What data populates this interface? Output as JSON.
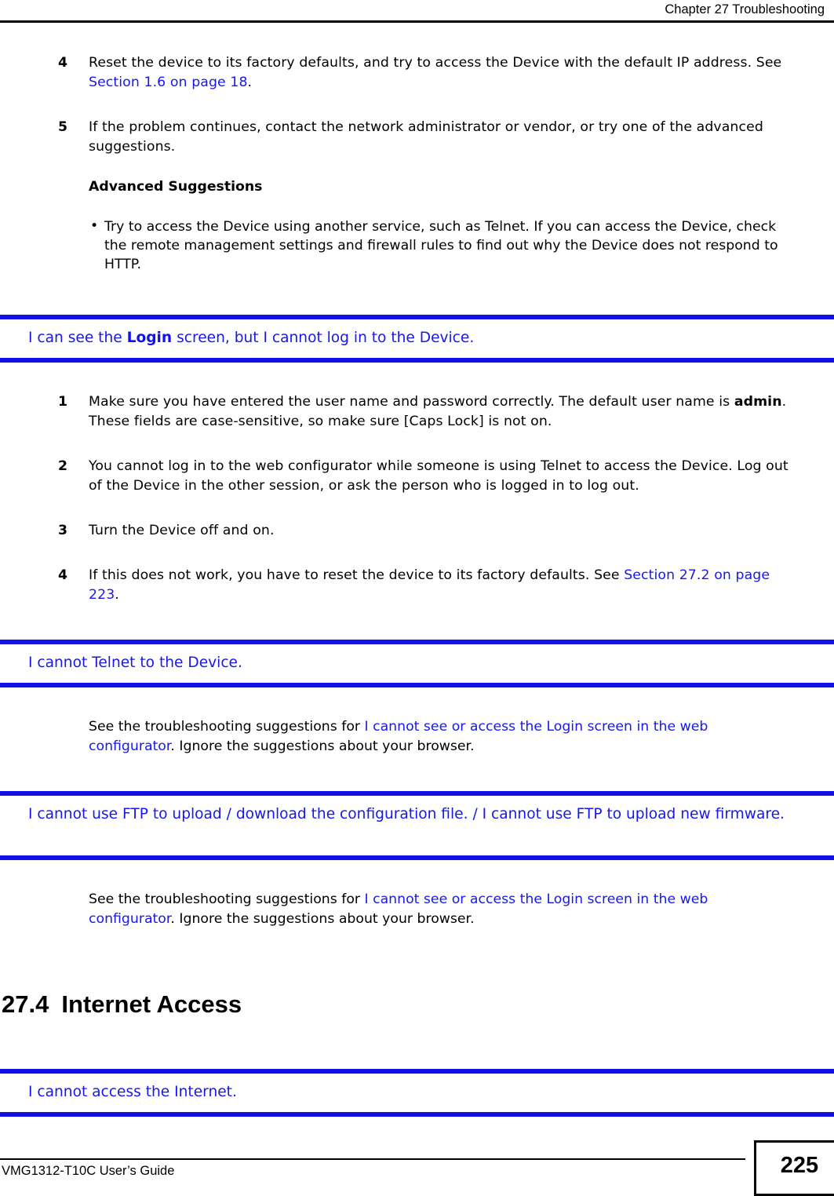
{
  "header": {
    "chapter_label": "Chapter 27 Troubleshooting"
  },
  "colors": {
    "link_blue": "#1818ee",
    "heading_blue": "#1717ee",
    "rule_blue": "#1111ee",
    "text_black": "#000000"
  },
  "body": {
    "step_4": {
      "number": "4",
      "text_before": "Reset the device to its factory defaults, and try to access the Device with the default IP address. See ",
      "xref": "Section 1.6 on page 18",
      "text_after": "."
    },
    "step_5": {
      "number": "5",
      "text": "If the problem continues, contact the network administrator or vendor, or try one of the advanced suggestions."
    },
    "advanced_suggestions_label": "Advanced Suggestions",
    "advanced_bullet_1": {
      "bullet_glyph": "•",
      "text": "Try to access the Device using another service, such as Telnet. If you can access the Device, check the remote management settings and firewall rules to find out why the Device does not respond to HTTP."
    }
  },
  "question_login": {
    "text_before": "I can see the ",
    "bold": "Login",
    "text_after": " screen, but I cannot log in to the Device."
  },
  "login_steps": [
    {
      "number": "1",
      "text_before": "Make sure you have entered the user name and password correctly. The default user name is ",
      "bold": "admin",
      "text_after": ". These fields are case-sensitive, so make sure [Caps Lock] is not on."
    },
    {
      "number": "2",
      "text_before": "You cannot log in to the web configurator while someone is using Telnet to access the Device. Log out of the Device in the other session, or ask the person who is logged in to log out.",
      "bold": "",
      "text_after": ""
    },
    {
      "number": "3",
      "text_before": "Turn the Device off and on.",
      "bold": "",
      "text_after": ""
    },
    {
      "number": "4",
      "text_before": "If this does not work, you have to reset the device to its factory defaults. See ",
      "xref": "Section 27.2 on page 223",
      "text_after": "."
    }
  ],
  "question_telnet": {
    "text": "I cannot Telnet to the Device."
  },
  "telnet_answer": {
    "text_before": "See the troubleshooting suggestions for ",
    "xref": "I cannot see or access the Login screen in the web configurator",
    "text_after": ". Ignore the suggestions about your browser."
  },
  "question_ftp": {
    "text": "I cannot use FTP to upload / download the configuration file. / I cannot use FTP to upload new firmware."
  },
  "ftp_answer": {
    "text_before": "See the troubleshooting suggestions for ",
    "xref": "I cannot see or access the Login screen in the web configurator",
    "text_after": ". Ignore the suggestions about your browser."
  },
  "section_27_4": {
    "number": "27.4",
    "title": "Internet Access"
  },
  "question_internet": {
    "text": "I cannot access the Internet."
  },
  "footer": {
    "guide_name": "VMG1312-T10C User’s Guide",
    "page_number": "225"
  }
}
